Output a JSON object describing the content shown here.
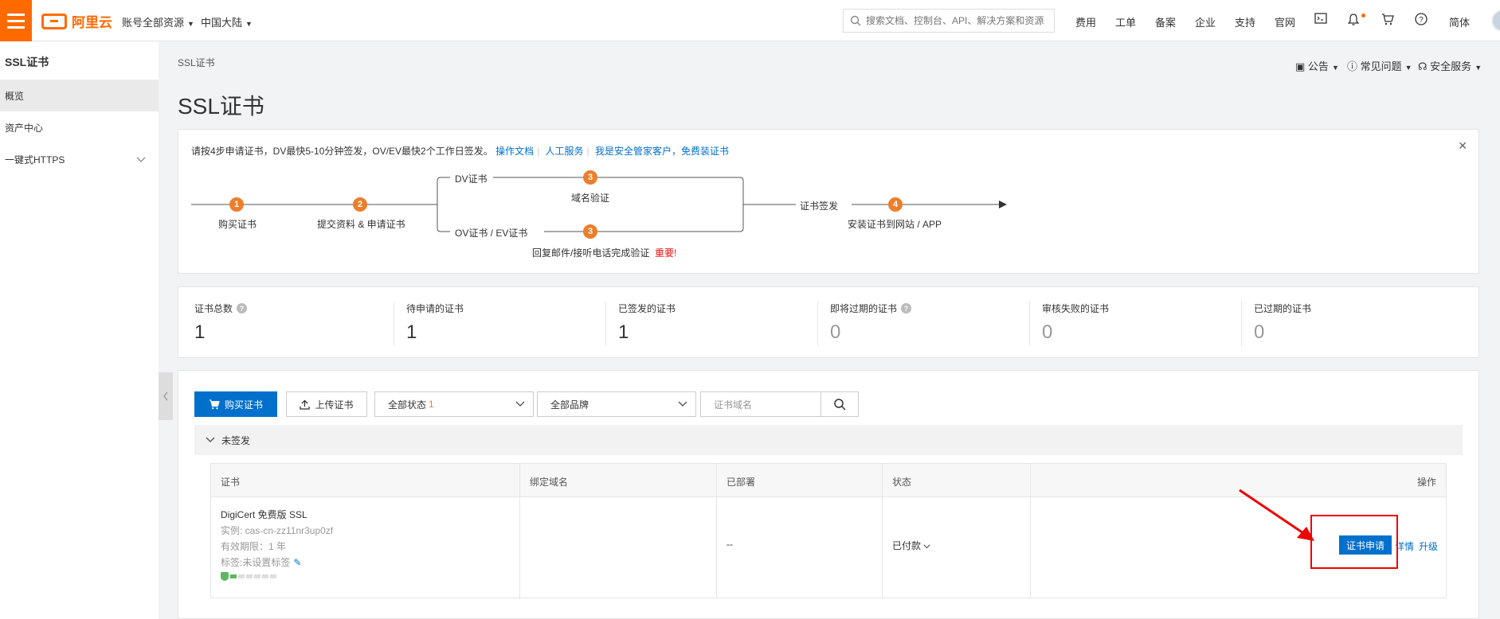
{
  "topbar": {
    "logo_text": "阿里云",
    "account_scope": "账号全部资源",
    "region": "中国大陆",
    "search_placeholder": "搜索文档、控制台、API、解决方案和资源",
    "nav": [
      "费用",
      "工单",
      "备案",
      "企业",
      "支持",
      "官网"
    ],
    "lang": "简体",
    "accent_color": "#ff6a00"
  },
  "sidebar": {
    "title": "SSL证书",
    "items": [
      {
        "label": "概览",
        "active": true
      },
      {
        "label": "资产中心",
        "active": false
      },
      {
        "label": "一键式HTTPS",
        "active": false
      }
    ]
  },
  "breadcrumb": "SSL证书",
  "header_links": {
    "announce": "公告",
    "faq": "常见问题",
    "security": "安全服务"
  },
  "page_title": "SSL证书",
  "guide": {
    "tip": "请按4步申请证书，DV最快5-10分钟签发，OV/EV最快2个工作日签发。",
    "links": [
      "操作文档",
      "人工服务",
      "我是安全管家客户，免费装证书"
    ],
    "steps": {
      "s1_num": "1",
      "s1": "购买证书",
      "s2_num": "2",
      "s2": "提交资料 & 申请证书",
      "dv": "DV证书",
      "s3_num": "3",
      "dv_step": "域名验证",
      "ovev": "OV证书 / EV证书",
      "ovev_step": "回复邮件/接听电话完成验证",
      "important": "重要!",
      "issue": "证书签发",
      "s4_num": "4",
      "s4": "安装证书到网站 / APP"
    }
  },
  "stats": [
    {
      "label": "证书总数",
      "value": "1",
      "help": true
    },
    {
      "label": "待申请的证书",
      "value": "1",
      "help": false
    },
    {
      "label": "已签发的证书",
      "value": "1",
      "help": false
    },
    {
      "label": "即将过期的证书",
      "value": "0",
      "help": true
    },
    {
      "label": "审核失败的证书",
      "value": "0",
      "help": false
    },
    {
      "label": "已过期的证书",
      "value": "0",
      "help": false
    }
  ],
  "toolbar": {
    "buy_label": "购买证书",
    "upload_label": "上传证书",
    "status_filter": "全部状态",
    "status_count": "1",
    "brand_filter": "全部品牌",
    "domain_placeholder": "证书域名"
  },
  "group_label": "未签发",
  "table": {
    "headers": [
      "证书",
      "绑定域名",
      "已部署",
      "状态",
      "操作"
    ],
    "rows": [
      {
        "name": "DigiCert 免费版 SSL",
        "instance": "实例: cas-cn-zz11nr3up0zf",
        "validity": "有效期限：1 年",
        "tags": "标签:未设置标签",
        "domain": "",
        "deployed": "--",
        "status": "已付款",
        "action_apply": "证书申请",
        "action_detail": "详情",
        "action_upgrade": "升级"
      }
    ]
  }
}
